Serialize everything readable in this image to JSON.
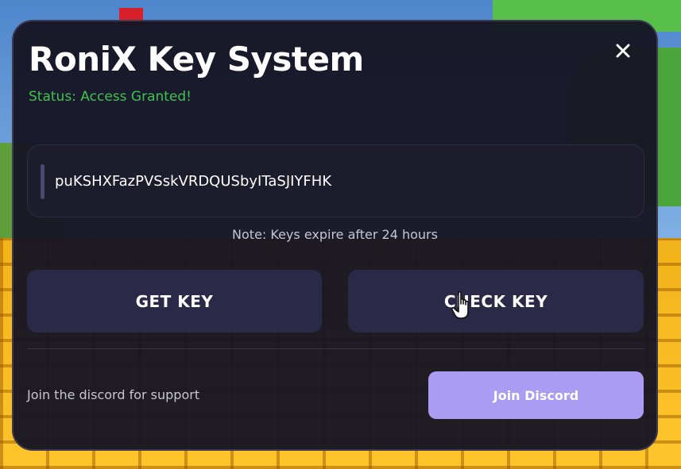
{
  "dialog": {
    "title": "RoniX Key System",
    "status": "Status: Access Granted!",
    "close_label": "X",
    "key_value": "puKSHXFazPVSskVRDQUSbyITaSJIYFHK",
    "note": "Note: Keys expire after 24 hours",
    "get_key_label": "GET KEY",
    "check_key_label": "CHECK KEY",
    "support_text": "Join the discord for support",
    "join_discord_label": "Join Discord"
  },
  "colors": {
    "panel_bg": "#161523",
    "status_green": "#3fc24f",
    "button_dark": "#2b2948",
    "discord_purple": "#a99cf2"
  },
  "icons": {
    "close": "close-icon",
    "cursor": "hand-pointer-cursor-icon"
  }
}
